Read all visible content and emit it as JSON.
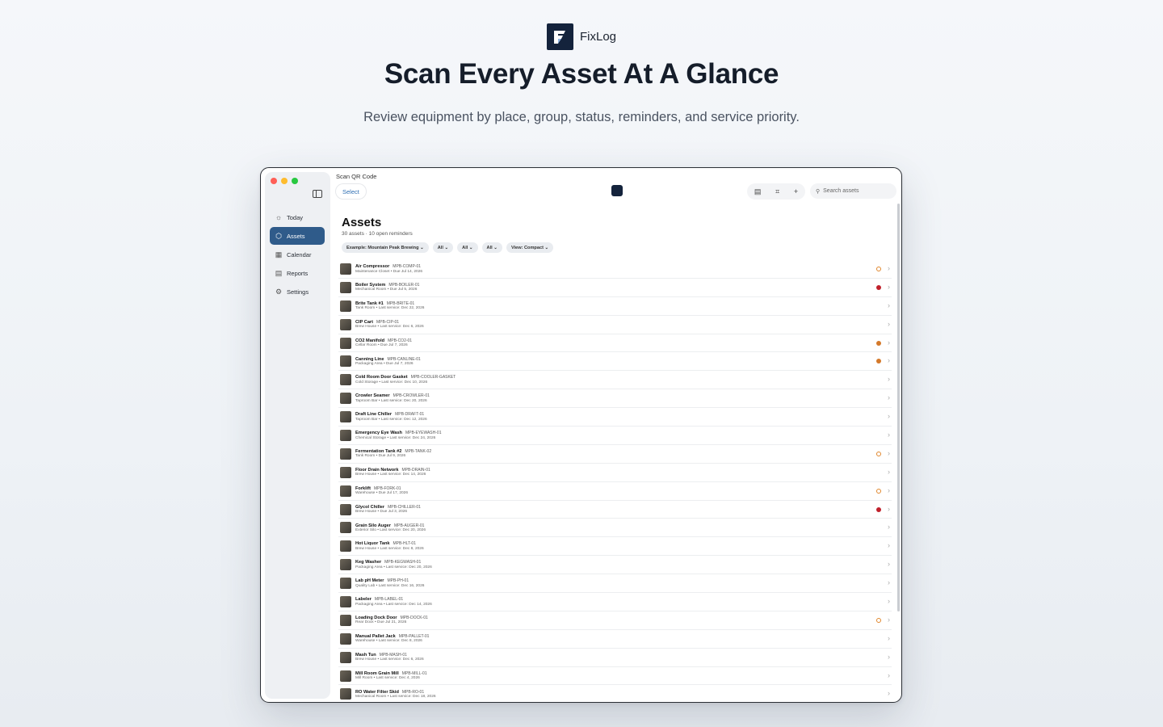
{
  "brand": {
    "name": "FixLog"
  },
  "hero": {
    "title": "Scan Every Asset At A Glance",
    "subtitle": "Review equipment by place, group, status, reminders, and service priority."
  },
  "app": {
    "topbar_title": "Scan QR Code",
    "select_label": "Select",
    "search_placeholder": "Search assets",
    "toolbar_icons": [
      "list-icon",
      "scan-icon",
      "plus-icon"
    ],
    "sidebar": {
      "items": [
        {
          "label": "Today",
          "icon": "sun-icon"
        },
        {
          "label": "Assets",
          "icon": "box-icon",
          "active": true
        },
        {
          "label": "Calendar",
          "icon": "calendar-icon"
        },
        {
          "label": "Reports",
          "icon": "reports-icon"
        },
        {
          "label": "Settings",
          "icon": "gear-icon"
        }
      ]
    },
    "content": {
      "title": "Assets",
      "summary": "30 assets · 10 open reminders",
      "filters": [
        "Example: Mountain Peak Brewing ⌄",
        "All ⌄",
        "All ⌄",
        "All ⌄",
        "View: Compact ⌄"
      ]
    },
    "assets": [
      {
        "name": "Air Compressor",
        "code": "MPB-COMP-01",
        "location": "Maintenance Closet",
        "detail": "Due Jul 14, 2026",
        "status": "warn"
      },
      {
        "name": "Boiler System",
        "code": "MPB-BOILER-01",
        "location": "Mechanical Room",
        "detail": "Due Jul 5, 2026",
        "status": "over"
      },
      {
        "name": "Brite Tank #1",
        "code": "MPB-BRITE-01",
        "location": "Tank Room",
        "detail": "Last service: Dec 22, 2026",
        "status": ""
      },
      {
        "name": "CIP Cart",
        "code": "MPB-CIP-01",
        "location": "Brew House",
        "detail": "Last service: Dec 6, 2026",
        "status": ""
      },
      {
        "name": "CO2 Manifold",
        "code": "MPB-CO2-01",
        "location": "Cellar Room",
        "detail": "Due Jul 7, 2026",
        "status": "due"
      },
      {
        "name": "Canning Line",
        "code": "MPB-CANLINE-01",
        "location": "Packaging Area",
        "detail": "Due Jul 7, 2026",
        "status": "due"
      },
      {
        "name": "Cold Room Door Gasket",
        "code": "MPB-COOLER-GASKET",
        "location": "Cold Storage",
        "detail": "Last service: Dec 10, 2026",
        "status": ""
      },
      {
        "name": "Crowler Seamer",
        "code": "MPB-CROWLER-01",
        "location": "Taproom Bar",
        "detail": "Last service: Dec 20, 2026",
        "status": ""
      },
      {
        "name": "Draft Line Chiller",
        "code": "MPB-DRAFT-01",
        "location": "Taproom Bar",
        "detail": "Last service: Dec 12, 2026",
        "status": ""
      },
      {
        "name": "Emergency Eye Wash",
        "code": "MPB-EYEWASH-01",
        "location": "Chemical Storage",
        "detail": "Last service: Dec 24, 2026",
        "status": ""
      },
      {
        "name": "Fermentation Tank #2",
        "code": "MPB-TANK-02",
        "location": "Tank Room",
        "detail": "Due Jul 9, 2026",
        "status": "warn"
      },
      {
        "name": "Floor Drain Network",
        "code": "MPB-DRAIN-01",
        "location": "Brew House",
        "detail": "Last service: Dec 14, 2026",
        "status": ""
      },
      {
        "name": "Forklift",
        "code": "MPB-FORK-01",
        "location": "Warehouse",
        "detail": "Due Jul 17, 2026",
        "status": "warn"
      },
      {
        "name": "Glycol Chiller",
        "code": "MPB-CHILLER-01",
        "location": "Brew House",
        "detail": "Due Jul 3, 2026",
        "status": "over"
      },
      {
        "name": "Grain Silo Auger",
        "code": "MPB-AUGER-01",
        "location": "Exterior Silo",
        "detail": "Last service: Dec 20, 2026",
        "status": ""
      },
      {
        "name": "Hot Liquor Tank",
        "code": "MPB-HLT-01",
        "location": "Brew House",
        "detail": "Last service: Dec 8, 2026",
        "status": ""
      },
      {
        "name": "Keg Washer",
        "code": "MPB-KEGWASH-01",
        "location": "Packaging Area",
        "detail": "Last service: Dec 20, 2026",
        "status": ""
      },
      {
        "name": "Lab pH Meter",
        "code": "MPB-PH-01",
        "location": "Quality Lab",
        "detail": "Last service: Dec 16, 2026",
        "status": ""
      },
      {
        "name": "Labeler",
        "code": "MPB-LABEL-01",
        "location": "Packaging Area",
        "detail": "Last service: Dec 14, 2026",
        "status": ""
      },
      {
        "name": "Loading Dock Door",
        "code": "MPB-DOCK-01",
        "location": "Rear Dock",
        "detail": "Due Jul 21, 2026",
        "status": "warn"
      },
      {
        "name": "Manual Pallet Jack",
        "code": "MPB-PALLET-01",
        "location": "Warehouse",
        "detail": "Last service: Dec 8, 2026",
        "status": ""
      },
      {
        "name": "Mash Tun",
        "code": "MPB-MASH-01",
        "location": "Brew House",
        "detail": "Last service: Dec 6, 2026",
        "status": ""
      },
      {
        "name": "Mill Room Grain Mill",
        "code": "MPB-MILL-01",
        "location": "Mill Room",
        "detail": "Last service: Dec 4, 2026",
        "status": ""
      },
      {
        "name": "RO Water Filter Skid",
        "code": "MPB-RO-01",
        "location": "Mechanical Room",
        "detail": "Last service: Dec 18, 2026",
        "status": ""
      }
    ]
  }
}
